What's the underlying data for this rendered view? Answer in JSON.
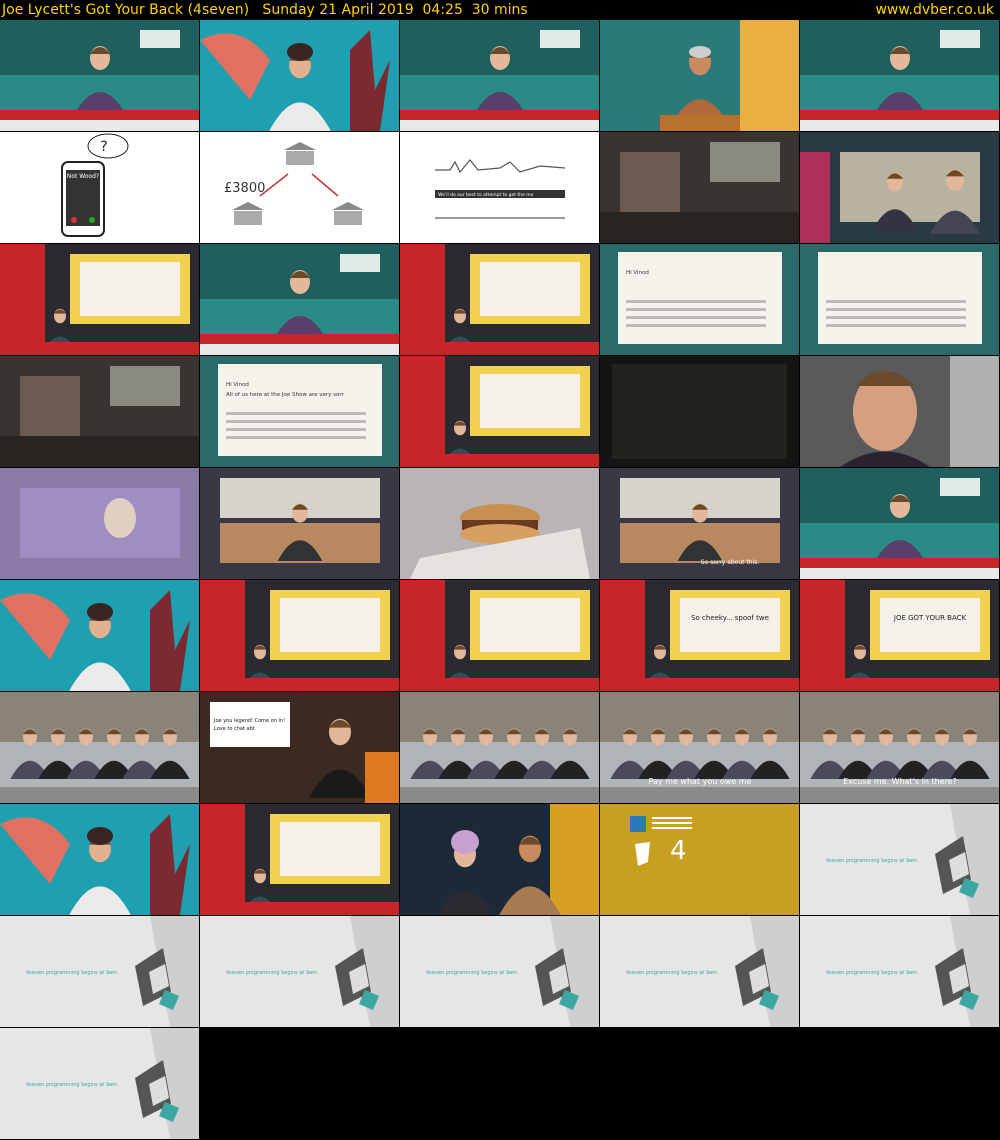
{
  "header": {
    "title": "Joe Lycett's Got Your Back (4seven)   Sunday 21 April 2019  04:25  30 mins",
    "site": "www.dvber.co.uk"
  },
  "colors": {
    "header_text": "#ffd200",
    "background": "#000000",
    "studio_teal": "#2a8a86",
    "studio_red": "#c8252a",
    "ident_teal": "#3aa7a0"
  },
  "frames": [
    {
      "kind": "studio",
      "icon": "presenter-icon"
    },
    {
      "kind": "guest",
      "icon": "guest-woman-icon"
    },
    {
      "kind": "studio",
      "icon": "presenter-icon"
    },
    {
      "kind": "guest-man",
      "icon": "guest-man-icon"
    },
    {
      "kind": "studio",
      "icon": "presenter-icon"
    },
    {
      "kind": "phone",
      "icon": "phone-icon",
      "text": "Not Wood?"
    },
    {
      "kind": "banks",
      "icon": "bank-icon",
      "text": "£3800"
    },
    {
      "kind": "waveform",
      "icon": "waveform-icon",
      "text": "We'll do our best to attempt to get the money back..."
    },
    {
      "kind": "dark",
      "icon": "blurred-scene-icon"
    },
    {
      "kind": "office",
      "icon": "office-scene-icon"
    },
    {
      "kind": "studio-screen",
      "icon": "screen-icon"
    },
    {
      "kind": "studio",
      "icon": "presenter-icon"
    },
    {
      "kind": "studio-screen",
      "icon": "screen-icon"
    },
    {
      "kind": "letter",
      "icon": "letter-icon",
      "text": "Hi Vinod"
    },
    {
      "kind": "letter",
      "icon": "letter-icon"
    },
    {
      "kind": "dark",
      "icon": "food-icon"
    },
    {
      "kind": "letter",
      "icon": "letter-icon",
      "text": "Hi Vinod\nAll of us here at the Joe Show are very sorry you cannot relate to our questions."
    },
    {
      "kind": "studio-screen",
      "icon": "screen-icon"
    },
    {
      "kind": "black",
      "icon": "dark-frame-icon"
    },
    {
      "kind": "closeup",
      "icon": "presenter-icon"
    },
    {
      "kind": "purple",
      "icon": "purple-scene-icon"
    },
    {
      "kind": "shop",
      "icon": "shop-icon"
    },
    {
      "kind": "burger",
      "icon": "burger-icon"
    },
    {
      "kind": "shop",
      "icon": "shop-icon",
      "text": "So sorry about this."
    },
    {
      "kind": "studio",
      "icon": "presenter-icon"
    },
    {
      "kind": "guest",
      "icon": "guest-woman-icon"
    },
    {
      "kind": "studio-screen",
      "icon": "screen-icon"
    },
    {
      "kind": "studio-screen",
      "icon": "screen-icon"
    },
    {
      "kind": "studio-screen",
      "icon": "screen-icon",
      "text": "So cheeky... spoof tweets hit bum note for RBS boss"
    },
    {
      "kind": "studio-screen",
      "icon": "screen-icon",
      "text": "JOE GOT YOUR BACK"
    },
    {
      "kind": "street",
      "icon": "crowd-icon"
    },
    {
      "kind": "tweet",
      "icon": "tweet-icon",
      "text": "Joe you legend! Come on in! Love to chat abt"
    },
    {
      "kind": "street",
      "icon": "crowd-icon"
    },
    {
      "kind": "street",
      "icon": "crowd-icon",
      "text": "Pay me what you owe me"
    },
    {
      "kind": "street",
      "icon": "crowd-icon",
      "text": "Excuse me. What's in there?"
    },
    {
      "kind": "guest",
      "icon": "guest-woman-icon"
    },
    {
      "kind": "studio-screen",
      "icon": "screen-icon"
    },
    {
      "kind": "audience",
      "icon": "audience-icon"
    },
    {
      "kind": "credits",
      "icon": "channel4-logo-icon"
    },
    {
      "kind": "ident",
      "icon": "4seven-logo-icon",
      "text": "4seven programming begins at 9am"
    },
    {
      "kind": "ident",
      "icon": "4seven-logo-icon",
      "text": "4seven programming begins at 9am"
    },
    {
      "kind": "ident",
      "icon": "4seven-logo-icon",
      "text": "4seven programming begins at 9am"
    },
    {
      "kind": "ident",
      "icon": "4seven-logo-icon",
      "text": "4seven programming begins at 9am"
    },
    {
      "kind": "ident",
      "icon": "4seven-logo-icon",
      "text": "4seven programming begins at 9am"
    },
    {
      "kind": "ident",
      "icon": "4seven-logo-icon",
      "text": "4seven programming begins at 9am"
    },
    {
      "kind": "ident",
      "icon": "4seven-logo-icon",
      "text": "4seven programming begins at 9am"
    }
  ]
}
